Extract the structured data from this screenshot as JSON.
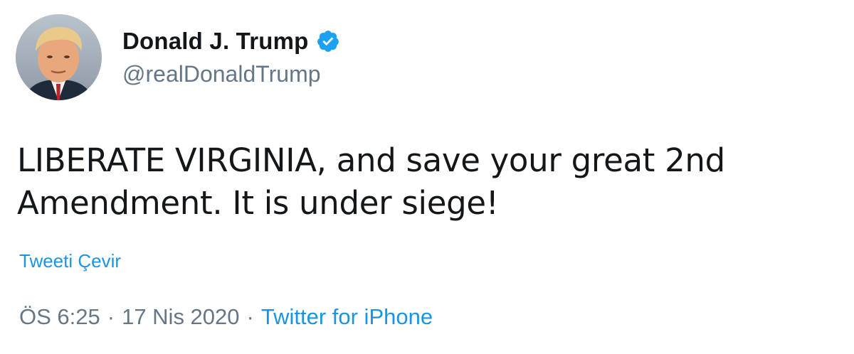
{
  "user": {
    "display_name": "Donald J. Trump",
    "handle": "@realDonaldTrump",
    "verified_icon": "verified-badge-icon",
    "verified_color": "#1da1f2"
  },
  "tweet": {
    "text_line_1": "LIBERATE VIRGINIA, and save your great 2nd",
    "text_line_2": "Amendment. It is under siege!",
    "translate_label": "Tweeti Çevir"
  },
  "meta": {
    "time": "ÖS 6:25",
    "separator": "·",
    "date": "17 Nis 2020",
    "source": "Twitter for iPhone"
  },
  "colors": {
    "link": "#1b95e0",
    "secondary_text": "#657786",
    "primary_text": "#14171a"
  }
}
